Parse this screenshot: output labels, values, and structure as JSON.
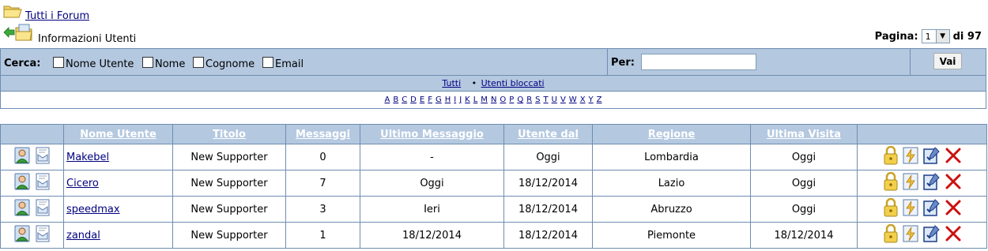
{
  "breadcrumb": {
    "forum_link": "Tutti i Forum",
    "page_title": "Informazioni Utenti"
  },
  "pager": {
    "label": "Pagina:",
    "current": "1",
    "total_text": "di 97"
  },
  "search": {
    "label": "Cerca:",
    "options": [
      "Nome Utente",
      "Nome",
      "Cognome",
      "Email"
    ],
    "per_label": "Per:",
    "per_value": "",
    "go_button": "Vai"
  },
  "filters": {
    "all": "Tutti",
    "blocked": "Utenti bloccati"
  },
  "letters": [
    "A",
    "B",
    "C",
    "D",
    "E",
    "F",
    "G",
    "H",
    "I",
    "J",
    "K",
    "L",
    "M",
    "N",
    "O",
    "P",
    "Q",
    "R",
    "S",
    "T",
    "U",
    "V",
    "W",
    "X",
    "Y",
    "Z"
  ],
  "table": {
    "headers": [
      "Nome Utente",
      "Titolo",
      "Messaggi",
      "Ultimo Messaggio",
      "Utente dal",
      "Regione",
      "Ultima Visita"
    ],
    "rows": [
      {
        "name": "Makebel",
        "title": "New Supporter",
        "posts": "0",
        "last_post": "-",
        "since": "Oggi",
        "region": "Lombardia",
        "last_visit": "Oggi"
      },
      {
        "name": "Cicero",
        "title": "New Supporter",
        "posts": "7",
        "last_post": "Oggi",
        "since": "18/12/2014",
        "region": "Lazio",
        "last_visit": "Oggi"
      },
      {
        "name": "speedmax",
        "title": "New Supporter",
        "posts": "3",
        "last_post": "Ieri",
        "since": "18/12/2014",
        "region": "Abruzzo",
        "last_visit": "Oggi"
      },
      {
        "name": "zandal",
        "title": "New Supporter",
        "posts": "1",
        "last_post": "18/12/2014",
        "since": "18/12/2014",
        "region": "Piemonte",
        "last_visit": "18/12/2014"
      }
    ]
  },
  "icons": {
    "row_left": [
      "profile-icon",
      "message-icon"
    ],
    "row_right": [
      "lock-icon",
      "lightning-icon",
      "edit-icon",
      "delete-icon"
    ]
  },
  "colors": {
    "header_bg": "#b4c8e0",
    "border": "#6f8db0",
    "link": "#000080",
    "delete": "#cc0000"
  }
}
